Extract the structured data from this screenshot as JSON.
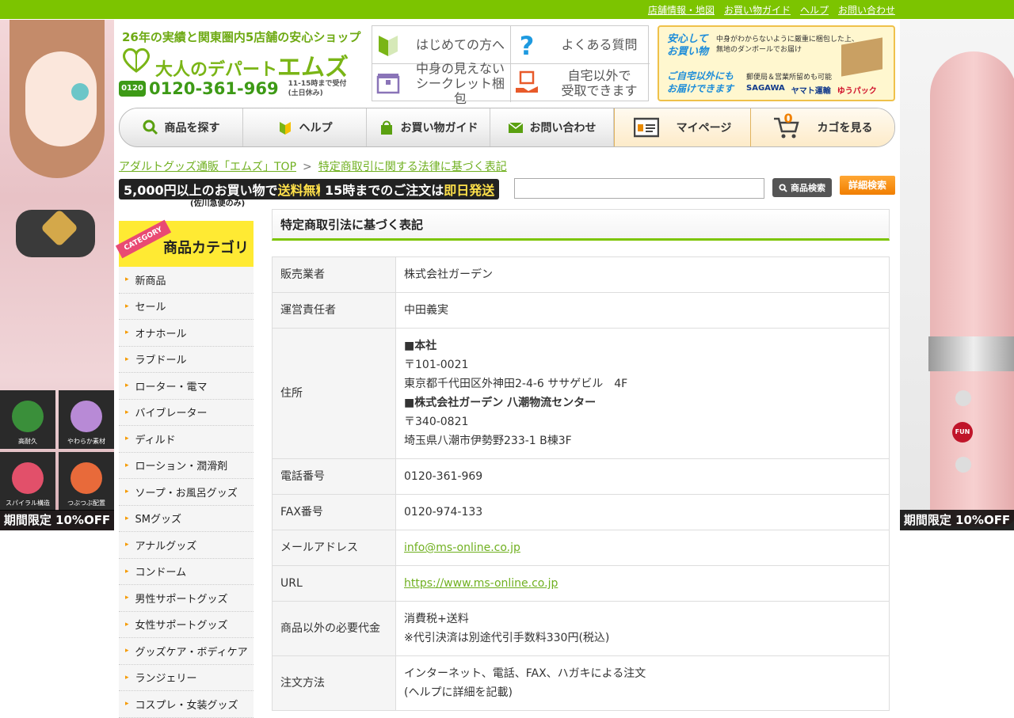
{
  "toplinks": [
    "店舗情報・地図",
    "お買い物ガイド",
    "ヘルプ",
    "お問い合わせ"
  ],
  "logo": {
    "tagline": "26年の実績と関東圏内5店舗の安心ショップ",
    "name_prefix": "大人のデパート",
    "name_main": "エムズ",
    "free_dial": "0120",
    "phone": "0120-361-969",
    "hours_1": "11-15時まで受付",
    "hours_2": "(土日休み)"
  },
  "quick_links": [
    {
      "label": "はじめての方へ",
      "icon": "leaf-icon"
    },
    {
      "label": "よくある質問",
      "icon": "question-icon"
    },
    {
      "label": "中身の見えない\nシークレット梱包",
      "icon": "box-icon"
    },
    {
      "label": "自宅以外で\n受取できます",
      "icon": "hand-box-icon"
    }
  ],
  "shipping": {
    "headline_1": "安心して\nお買い物",
    "text_1": "中身がわからないように厳重に梱包した上、\n無地のダンボールでお届け",
    "headline_2": "ご自宅以外にも\nお届けできます",
    "text_2": "郵便局＆営業所留めも可能",
    "carriers": [
      "SAGAWA",
      "ヤマト運輸",
      "ゆうパック"
    ]
  },
  "nav": [
    {
      "label": "商品を探す",
      "icon": "search-icon"
    },
    {
      "label": "ヘルプ",
      "icon": "leaf-icon"
    },
    {
      "label": "お買い物ガイド",
      "icon": "bag-icon"
    },
    {
      "label": "お問い合わせ",
      "icon": "mail-icon"
    },
    {
      "label": "マイページ",
      "icon": "id-card-icon"
    },
    {
      "label": "カゴを見る",
      "icon": "cart-icon",
      "badge": "0"
    }
  ],
  "breadcrumb": {
    "home": "アダルトグッズ通販「エムズ」TOP",
    "sep": ">",
    "current": "特定商取引に関する法律に基づく表記"
  },
  "promo": {
    "a_pre": "5,000円以上のお買い物で",
    "a_hl": "送料無料",
    "b_pre": "15時までのご注文は",
    "b_hl": "即日発送",
    "note": "(佐川急便のみ)"
  },
  "search": {
    "button": "商品検索",
    "advanced": "詳細検索"
  },
  "category": {
    "ribbon": "CATEGORY",
    "title": "商品カテゴリ",
    "items": [
      "新商品",
      "セール",
      "オナホール",
      "ラブドール",
      "ローター・電マ",
      "バイブレーター",
      "ディルド",
      "ローション・潤滑剤",
      "ソープ・お風呂グッズ",
      "SMグッズ",
      "アナルグッズ",
      "コンドーム",
      "男性サポートグッズ",
      "女性サポートグッズ",
      "グッズケア・ボディケア",
      "ランジェリー",
      "コスプレ・女装グッズ"
    ]
  },
  "side_banners": {
    "left_features": [
      "高耐久",
      "やわらか素材",
      "スパイラル構造",
      "つぶつぶ配置"
    ],
    "promo": "期間限定 10%OFF",
    "toy_logo": "FUN"
  },
  "page": {
    "title": "特定商取引法に基づく表記",
    "rows": [
      {
        "key": "販売業者",
        "lines": [
          "株式会社ガーデン"
        ]
      },
      {
        "key": "運営責任者",
        "lines": [
          "中田義実"
        ]
      },
      {
        "key": "住所",
        "lines": [
          "■本社",
          "〒101-0021",
          "東京都千代田区外神田2-4-6 ササゲビル　4F",
          "■株式会社ガーデン 八潮物流センター",
          "〒340-0821",
          "埼玉県八潮市伊勢野233-1 B棟3F"
        ],
        "bold": [
          0,
          3
        ]
      },
      {
        "key": "電話番号",
        "lines": [
          "0120-361-969"
        ]
      },
      {
        "key": "FAX番号",
        "lines": [
          "0120-974-133"
        ]
      },
      {
        "key": "メールアドレス",
        "lines": [
          "info@ms-online.co.jp"
        ],
        "link": true
      },
      {
        "key": "URL",
        "lines": [
          "https://www.ms-online.co.jp"
        ],
        "link": true
      },
      {
        "key": "商品以外の必要代金",
        "lines": [
          "消費税+送料",
          "※代引決済は別途代引手数料330円(税込)"
        ]
      },
      {
        "key": "注文方法",
        "lines": [
          "インターネット、電話、FAX、ハガキによる注文",
          "(ヘルプに詳細を記載)"
        ]
      }
    ]
  },
  "colors": {
    "brand_green": "#7cc400",
    "link_green": "#70b020",
    "accent_orange": "#f17e00"
  }
}
